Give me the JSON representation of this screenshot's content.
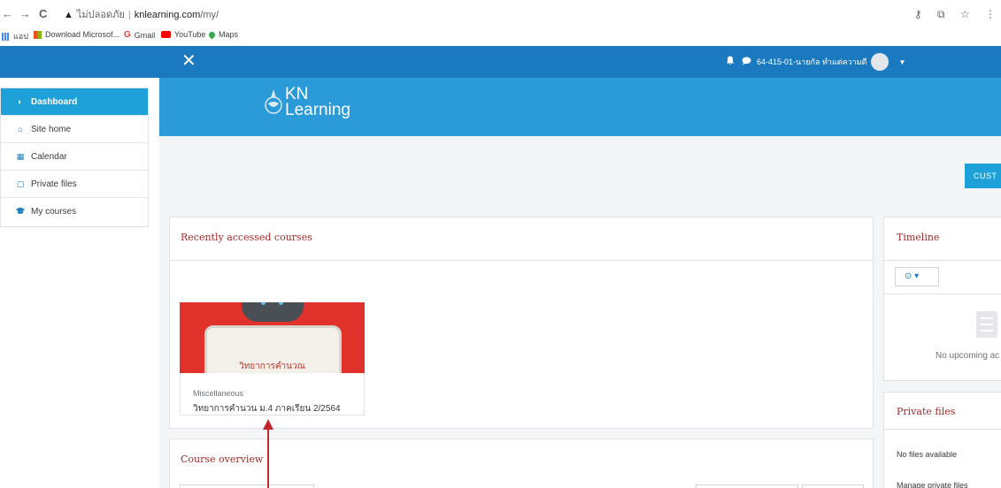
{
  "browser": {
    "back": "←",
    "forward": "→",
    "reload": "C",
    "security_warning": "▲",
    "security_label": "ไม่ปลอดภัย",
    "host": "knlearning.com",
    "path": "/my/",
    "right_icons": [
      "key-icon",
      "translate-icon",
      "star-icon",
      "more-icon"
    ]
  },
  "bookmarks": [
    {
      "label": "แอป",
      "icon": "apps-icon",
      "color": "#4285f4"
    },
    {
      "label": "Download Microsof...",
      "icon": "microsoft-icon",
      "color": "#f25022"
    },
    {
      "label": "Gmail",
      "icon": "google-icon",
      "color": "#ea4335"
    },
    {
      "label": "YouTube",
      "icon": "youtube-icon",
      "color": "#ff0000"
    },
    {
      "label": "Maps",
      "icon": "maps-icon",
      "color": "#34a853"
    }
  ],
  "navbar": {
    "close_symbol": "✕",
    "user_name": "64-415-01-นายกัล ทำแต่ความดี",
    "bell": "🔔",
    "chat": "💬",
    "caret": "▼",
    "color": "#1b79c0"
  },
  "drawer": {
    "items": [
      {
        "label": "Dashboard",
        "icon": "dashboard-icon",
        "glyph": "◐",
        "active": true
      },
      {
        "label": "Site home",
        "icon": "home-icon",
        "glyph": "⌂",
        "active": false
      },
      {
        "label": "Calendar",
        "icon": "calendar-icon",
        "glyph": "▦",
        "active": false
      },
      {
        "label": "Private files",
        "icon": "file-icon",
        "glyph": "▢",
        "active": false
      },
      {
        "label": "My courses",
        "icon": "graduation-cap-icon",
        "glyph": "🎓",
        "active": false
      }
    ]
  },
  "brand": {
    "line1": "KN",
    "line2": "Learning"
  },
  "customise_button": "CUST",
  "recent": {
    "title": "Recently accessed courses",
    "course": {
      "image_text": "วิทยาการคำนวณ",
      "category": "Miscellaneous",
      "name": "วิทยาการคำนวน ม.4 ภาคเรียน 2/2564"
    }
  },
  "overview": {
    "title": "Course overview"
  },
  "timeline": {
    "title": "Timeline",
    "filter_glyph": "⊙ ▾",
    "empty_text": "No upcoming ac"
  },
  "private_files": {
    "title": "Private files",
    "empty_text": "No files available",
    "manage_link": "Manage private files"
  },
  "colors": {
    "accent": "#1ea1d9",
    "header": "#2a9ad9",
    "title_red": "#a52a2a",
    "arrow": "#c0282d"
  }
}
